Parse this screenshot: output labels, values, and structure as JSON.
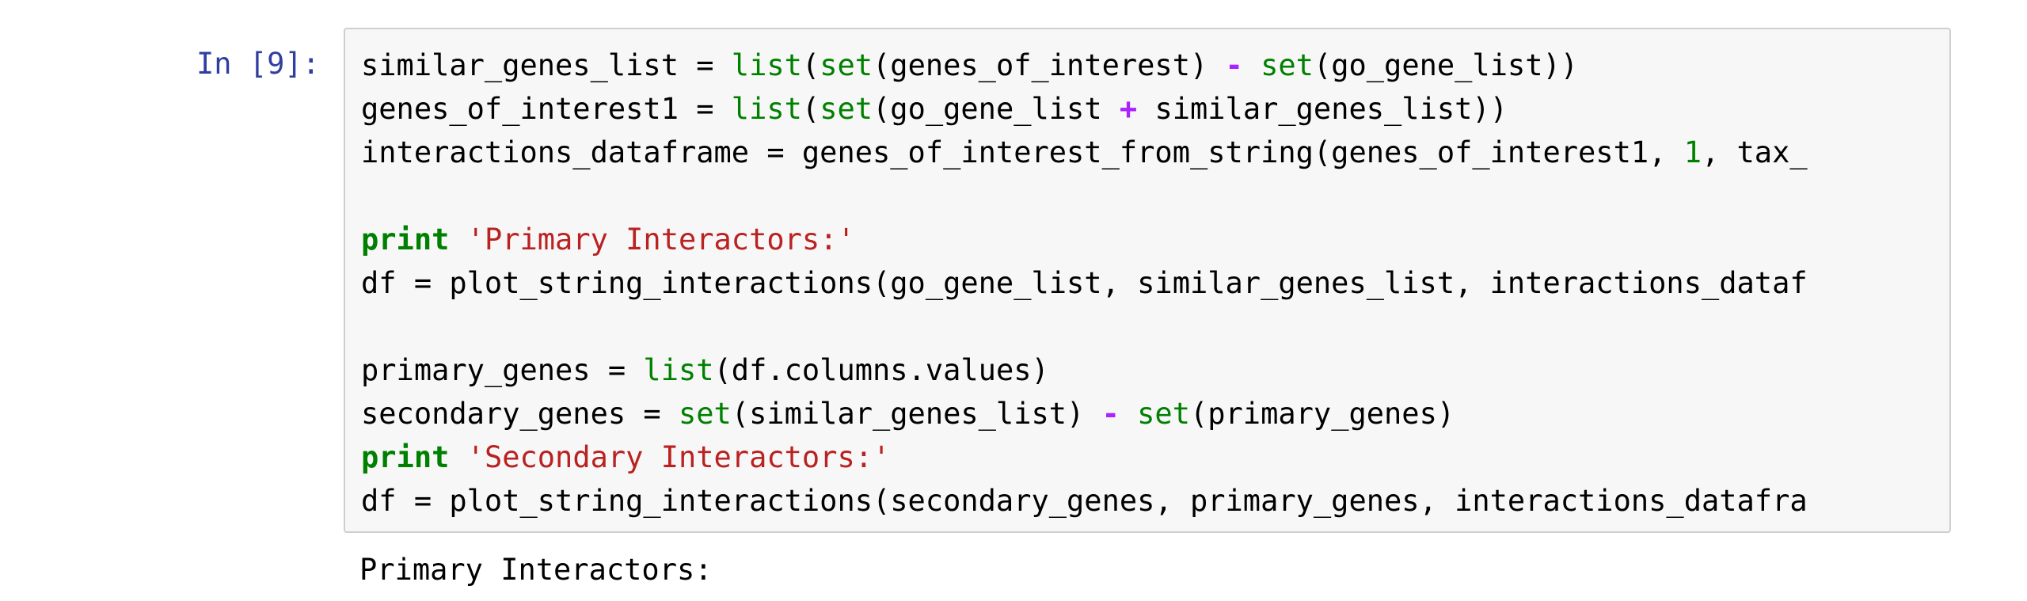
{
  "cell": {
    "prompt": "In [9]:",
    "code_lines": [
      [
        {
          "t": "similar_genes_list = ",
          "k": "name"
        },
        {
          "t": "list",
          "k": "builtin"
        },
        {
          "t": "(",
          "k": "name"
        },
        {
          "t": "set",
          "k": "builtin"
        },
        {
          "t": "(genes_of_interest) ",
          "k": "name"
        },
        {
          "t": "-",
          "k": "op"
        },
        {
          "t": " ",
          "k": "name"
        },
        {
          "t": "set",
          "k": "builtin"
        },
        {
          "t": "(go_gene_list))",
          "k": "name"
        }
      ],
      [
        {
          "t": "genes_of_interest1 = ",
          "k": "name"
        },
        {
          "t": "list",
          "k": "builtin"
        },
        {
          "t": "(",
          "k": "name"
        },
        {
          "t": "set",
          "k": "builtin"
        },
        {
          "t": "(go_gene_list ",
          "k": "name"
        },
        {
          "t": "+",
          "k": "op"
        },
        {
          "t": " similar_genes_list))",
          "k": "name"
        }
      ],
      [
        {
          "t": "interactions_dataframe = genes_of_interest_from_string(genes_of_interest1, ",
          "k": "name"
        },
        {
          "t": "1",
          "k": "number"
        },
        {
          "t": ", tax_",
          "k": "name"
        }
      ],
      [],
      [
        {
          "t": "print",
          "k": "keyword"
        },
        {
          "t": " ",
          "k": "name"
        },
        {
          "t": "'Primary Interactors:'",
          "k": "string"
        }
      ],
      [
        {
          "t": "df = plot_string_interactions(go_gene_list, similar_genes_list, interactions_dataf",
          "k": "name"
        }
      ],
      [],
      [
        {
          "t": "primary_genes = ",
          "k": "name"
        },
        {
          "t": "list",
          "k": "builtin"
        },
        {
          "t": "(df.columns.values)",
          "k": "name"
        }
      ],
      [
        {
          "t": "secondary_genes = ",
          "k": "name"
        },
        {
          "t": "set",
          "k": "builtin"
        },
        {
          "t": "(similar_genes_list) ",
          "k": "name"
        },
        {
          "t": "-",
          "k": "op"
        },
        {
          "t": " ",
          "k": "name"
        },
        {
          "t": "set",
          "k": "builtin"
        },
        {
          "t": "(primary_genes)",
          "k": "name"
        }
      ],
      [
        {
          "t": "print",
          "k": "keyword"
        },
        {
          "t": " ",
          "k": "name"
        },
        {
          "t": "'Secondary Interactors:'",
          "k": "string"
        }
      ],
      [
        {
          "t": "df = plot_string_interactions(secondary_genes, primary_genes, interactions_datafra",
          "k": "name"
        }
      ]
    ],
    "output_text": "Primary Interactors:"
  },
  "colors": {
    "prompt": "#303f9f",
    "builtin": "#008000",
    "keyword": "#008000",
    "operator": "#aa22ff",
    "string": "#ba2121",
    "input_background": "#f7f7f7",
    "input_border": "#cfcfcf"
  }
}
